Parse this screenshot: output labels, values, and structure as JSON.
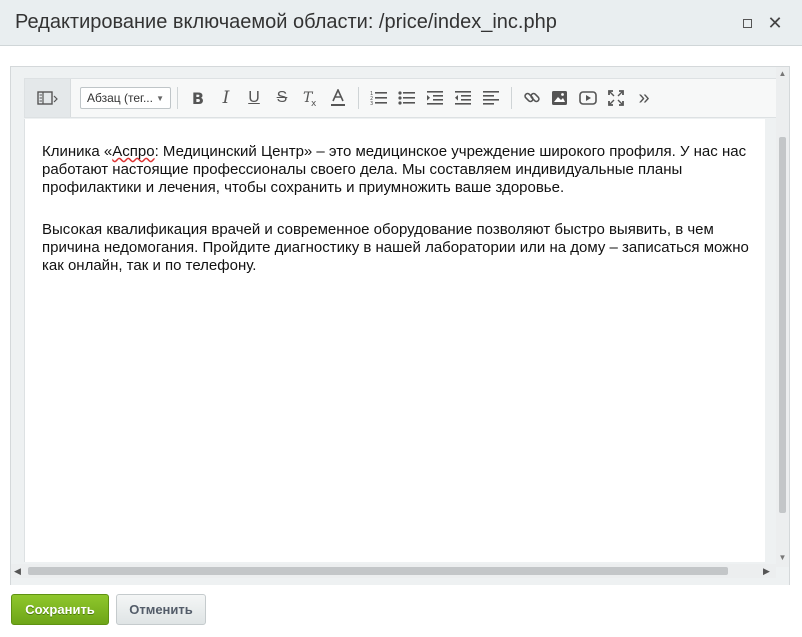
{
  "window": {
    "title": "Редактирование включаемой области: /price/index_inc.php"
  },
  "toolbar": {
    "format_select": "Абзац (тег..."
  },
  "document": {
    "paragraph1_start": "Клиника «",
    "paragraph1_spell": "Аспро",
    "paragraph1_rest": ": Медицинский Центр» – это медицинское учреждение широкого профиля. У нас нас работают настоящие профессионалы своего дела. Мы составляем индивидуальные планы профилактики и лечения, чтобы сохранить и приумножить ваше здоровье.",
    "paragraph2": "Высокая квалификация врачей и современное оборудование позволяют быстро выявить, в чем причина недомогания. Пройдите диагностику в нашей лаборатории или на дому – записаться можно как онлайн, так и по телефону."
  },
  "footer": {
    "save_label": "Сохранить",
    "cancel_label": "Отменить"
  }
}
